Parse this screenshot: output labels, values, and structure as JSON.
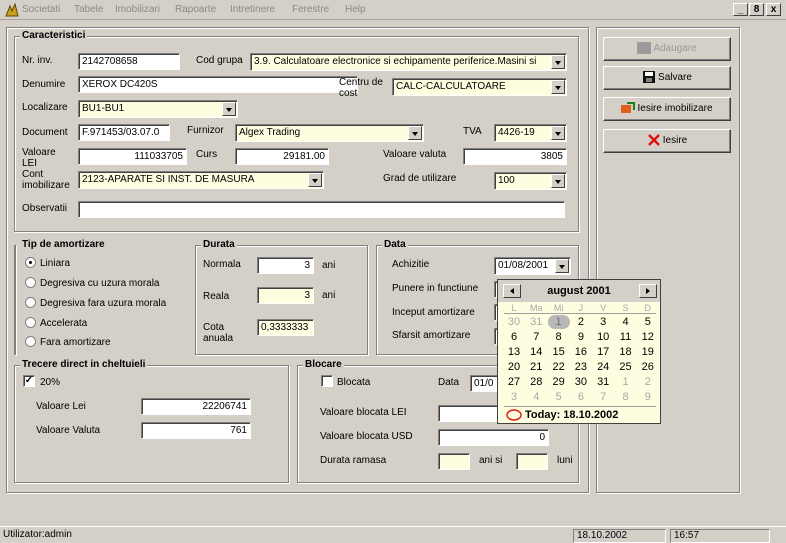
{
  "menu": [
    "Societati",
    "Tabele",
    "Imobilizari",
    "Rapoarte",
    "Intretinere",
    "Ferestre",
    "Help"
  ],
  "window_controls": {
    "minimize": "_",
    "restore": "8",
    "close": "x"
  },
  "caracteristici": {
    "legend": "Caracteristici",
    "nr_inv_label": "Nr. inv.",
    "nr_inv_value": "2142708658",
    "cod_grupa_label": "Cod grupa",
    "cod_grupa_value": "3.9. Calculatoare electronice si echipamente periferice.Masini si",
    "denumire_label": "Denumire",
    "denumire_value": "XEROX DC420S",
    "centru_cost_label_1": "Centru de",
    "centru_cost_label_2": "cost",
    "centru_cost_value": "CALC-CALCULATOARE",
    "localizare_label": "Localizare",
    "localizare_value": "BU1-BU1",
    "document_label": "Document",
    "document_value": "F.971453/03.07.0",
    "furnizor_label": "Furnizor",
    "furnizor_value": "Algex Trading",
    "tva_label": "TVA",
    "tva_value": "4426-19",
    "valoare_lei_label_1": "Valoare",
    "valoare_lei_label_2": "LEI",
    "valoare_lei_value": "111033705",
    "curs_label": "Curs",
    "curs_value": "29181.00",
    "valoare_valuta_label": "Valoare valuta",
    "valoare_valuta_value": "3805",
    "cont_label_1": "Cont",
    "cont_label_2": "imobilizare",
    "cont_value": "2123-APARATE SI INST. DE MASURA",
    "grad_label": "Grad de utilizare",
    "grad_value": "100",
    "observatii_label": "Observatii",
    "observatii_value": ""
  },
  "amortizare": {
    "legend": "Tip de amortizare",
    "options": [
      "Liniara",
      "Degresiva cu uzura morala",
      "Degresiva fara uzura morala",
      "Accelerata",
      "Fara amortizare"
    ],
    "selected": "Liniara"
  },
  "durata": {
    "legend": "Durata",
    "normala_label": "Normala",
    "normala_value": "3",
    "normala_unit": "ani",
    "reala_label": "Reala",
    "reala_value": "3",
    "reala_unit": "ani",
    "cota_label_1": "Cota",
    "cota_label_2": "anuala",
    "cota_value": "0,3333333"
  },
  "data_section": {
    "legend": "Data",
    "achizitie_label": "Achizitie",
    "achizitie_value": "01/08/2001",
    "punere_label": "Punere in functiune",
    "inceput_label": "Inceput amortizare",
    "sfarsit_label": "Sfarsit amortizare"
  },
  "trecere": {
    "legend": "Trecere direct in cheltuieli",
    "checkbox_label": "20%",
    "checked": true,
    "valoare_lei_label": "Valoare Lei",
    "valoare_lei_value": "22206741",
    "valoare_valuta_label": "Valoare Valuta",
    "valoare_valuta_value": "761"
  },
  "blocare": {
    "legend": "Blocare",
    "blocata_label": "Blocata",
    "data_label": "Data",
    "data_value": "01/0",
    "val_lei_label": "Valoare blocata LEI",
    "val_lei_value": "",
    "val_usd_label": "Valoare blocata USD",
    "val_usd_value": "0",
    "durata_label": "Durata ramasa",
    "ani_si": "ani si",
    "luni": "luni"
  },
  "buttons": {
    "adaugare": "Adaugare",
    "salvare": "Salvare",
    "iesire_imob": "Iesire imobilizare",
    "iesire": "Iesire"
  },
  "calendar": {
    "title": "august 2001",
    "weekdays": [
      "L",
      "Ma",
      "Mi",
      "J",
      "V",
      "S",
      "D"
    ],
    "weeks": [
      [
        "30",
        "31",
        "1",
        "2",
        "3",
        "4",
        "5"
      ],
      [
        "6",
        "7",
        "8",
        "9",
        "10",
        "11",
        "12"
      ],
      [
        "13",
        "14",
        "15",
        "16",
        "17",
        "18",
        "19"
      ],
      [
        "20",
        "21",
        "22",
        "23",
        "24",
        "25",
        "26"
      ],
      [
        "27",
        "28",
        "29",
        "30",
        "31",
        "1",
        "2"
      ],
      [
        "3",
        "4",
        "5",
        "6",
        "7",
        "8",
        "9"
      ]
    ],
    "selected_day": "1",
    "today": "Today: 18.10.2002"
  },
  "status": {
    "user": "Utilizator:admin",
    "date": "18.10.2002",
    "time": "16:57"
  }
}
